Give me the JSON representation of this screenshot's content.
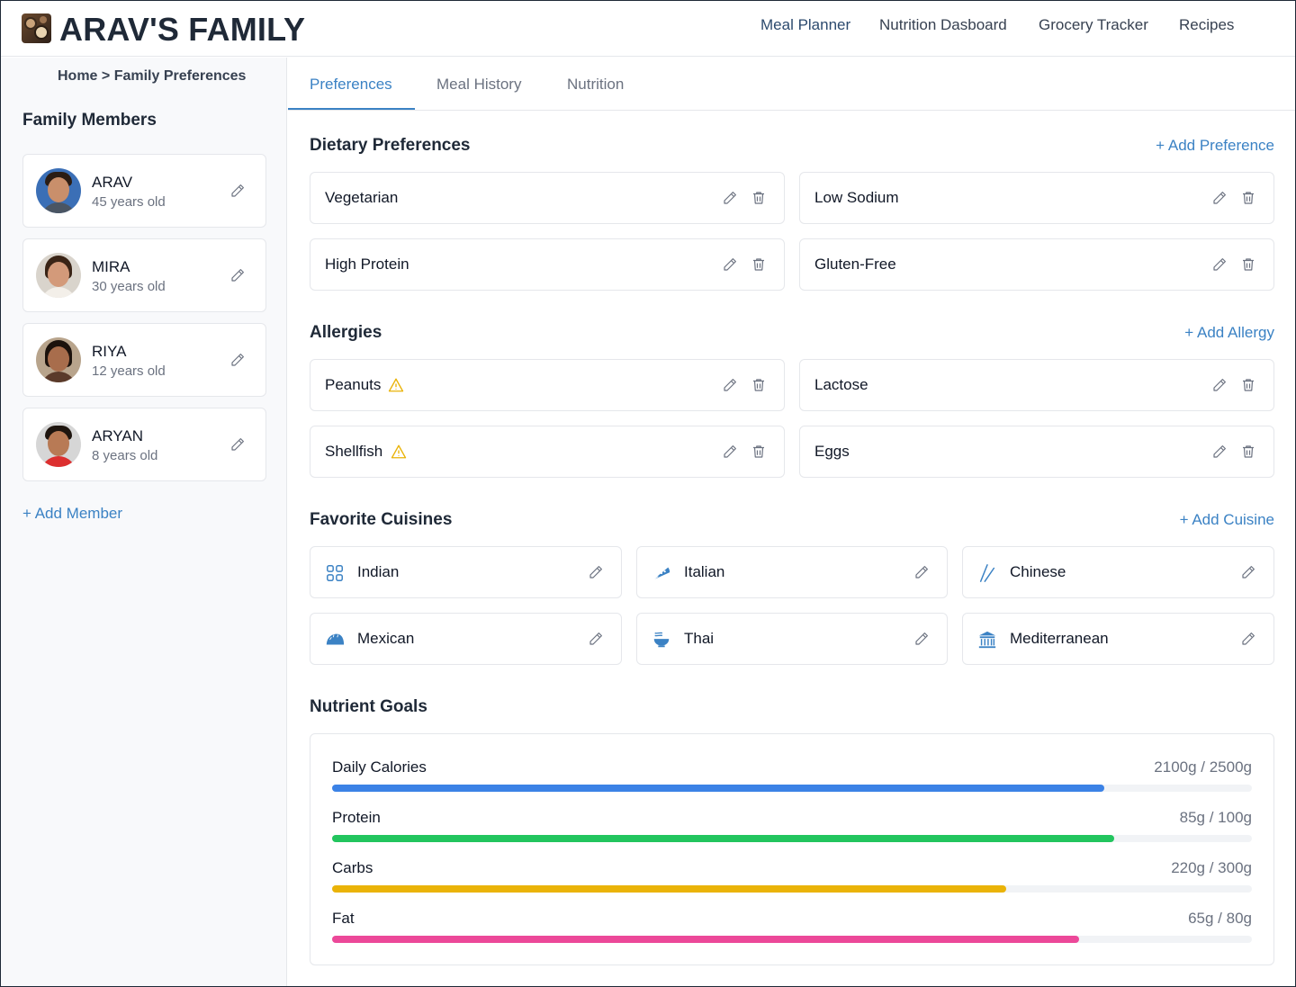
{
  "app": {
    "brand": "ARAV'S FAMILY"
  },
  "topnav": [
    {
      "label": "Meal Planner",
      "active": true
    },
    {
      "label": "Nutrition Dasboard",
      "active": false
    },
    {
      "label": "Grocery Tracker",
      "active": false
    },
    {
      "label": "Recipes",
      "active": false
    }
  ],
  "sidebar": {
    "breadcrumb": "Home > Family Preferences",
    "title": "Family Members",
    "members": [
      {
        "name": "ARAV",
        "age": "45 years old"
      },
      {
        "name": "MIRA",
        "age": "30 years old"
      },
      {
        "name": "RIYA",
        "age": "12 years old"
      },
      {
        "name": "ARYAN",
        "age": "8 years old"
      }
    ],
    "add_member": "+ Add Member"
  },
  "tabs": [
    {
      "label": "Preferences",
      "active": true
    },
    {
      "label": "Meal History",
      "active": false
    },
    {
      "label": "Nutrition",
      "active": false
    }
  ],
  "dietary": {
    "title": "Dietary Preferences",
    "action": "+ Add Preference",
    "items": [
      "Vegetarian",
      "Low Sodium",
      "High Protein",
      "Gluten-Free"
    ]
  },
  "allergies": {
    "title": "Allergies",
    "action": "+ Add Allergy",
    "items": [
      {
        "label": "Peanuts",
        "warning": true
      },
      {
        "label": "Lactose",
        "warning": false
      },
      {
        "label": "Shellfish",
        "warning": true
      },
      {
        "label": "Eggs",
        "warning": false
      }
    ]
  },
  "cuisines": {
    "title": "Favorite Cuisines",
    "action": "+ Add Cuisine",
    "items": [
      {
        "label": "Indian",
        "icon": "grid-icon"
      },
      {
        "label": "Italian",
        "icon": "pizza-icon"
      },
      {
        "label": "Chinese",
        "icon": "chopsticks-icon"
      },
      {
        "label": "Mexican",
        "icon": "taco-icon"
      },
      {
        "label": "Thai",
        "icon": "noodle-bowl-icon"
      },
      {
        "label": "Mediterranean",
        "icon": "temple-icon"
      }
    ]
  },
  "nutrients": {
    "title": "Nutrient Goals",
    "items": [
      {
        "label": "Daily Calories",
        "value": "2100g / 2500g",
        "ratio": 0.84,
        "color": "#3b82e6"
      },
      {
        "label": "Protein",
        "value": "85g / 100g",
        "ratio": 0.85,
        "color": "#22c55e"
      },
      {
        "label": "Carbs",
        "value": "220g / 300g",
        "ratio": 0.733,
        "color": "#eab308"
      },
      {
        "label": "Fat",
        "value": "65g / 80g",
        "ratio": 0.8125,
        "color": "#ec4899"
      }
    ]
  },
  "colors": {
    "accent": "#3b82c4",
    "warning": "#eab308"
  }
}
